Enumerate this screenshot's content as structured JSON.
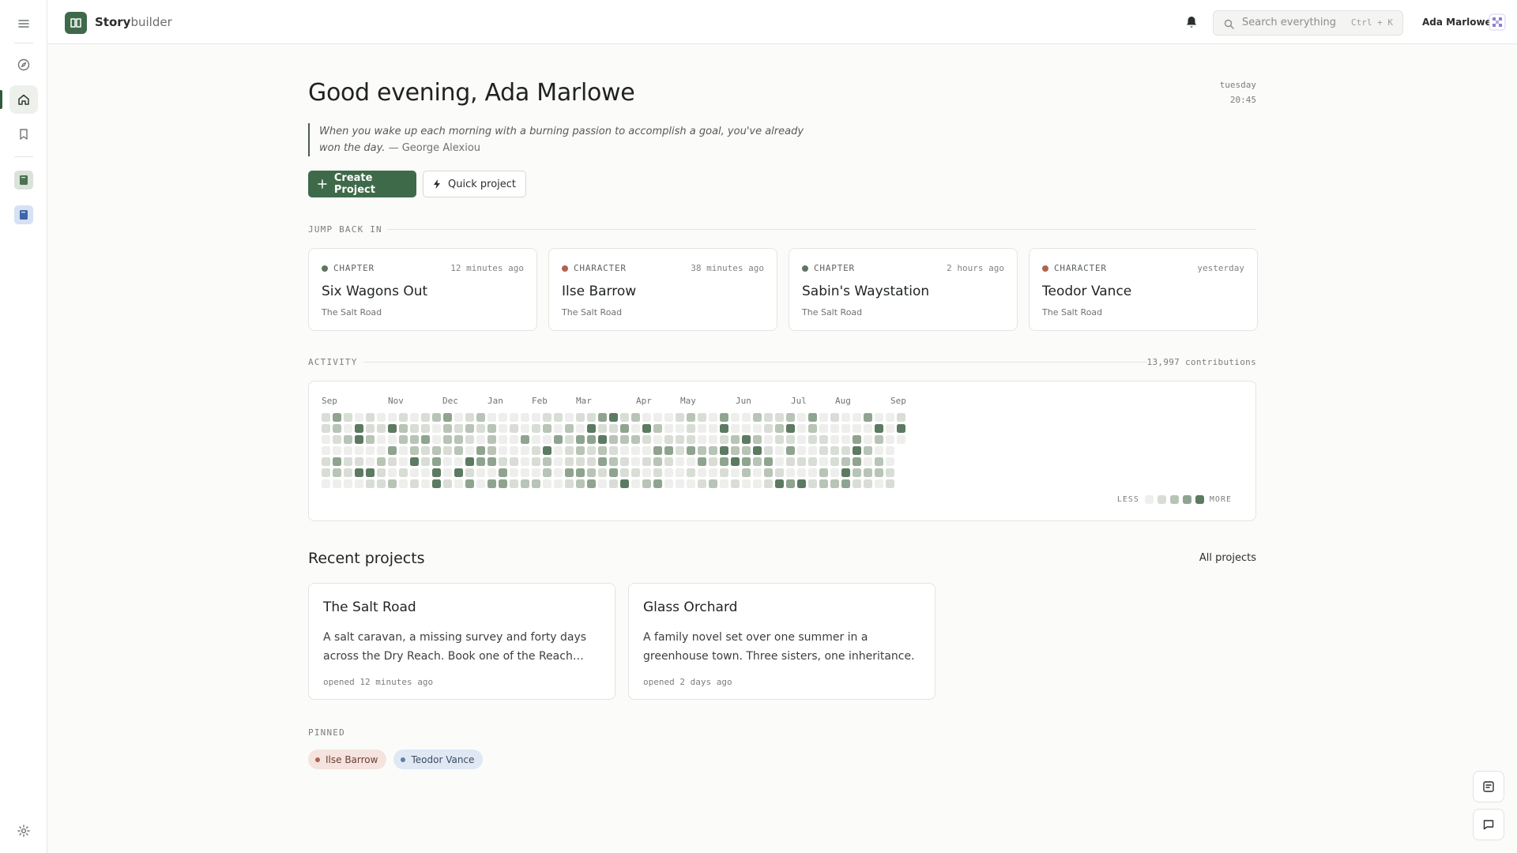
{
  "app": {
    "brand_bold": "Story",
    "brand_light": "builder"
  },
  "header": {
    "search_placeholder": "Search everything",
    "search_shortcut": "Ctrl + K",
    "user_name": "Ada Marlowe"
  },
  "sidebar": {
    "items": [
      {
        "name": "menu-icon"
      },
      {
        "name": "compass-icon"
      },
      {
        "name": "home-icon",
        "active": true
      },
      {
        "name": "bookmark-icon"
      },
      {
        "name": "book-green-icon"
      },
      {
        "name": "book-blue-icon"
      },
      {
        "name": "gear-icon"
      }
    ]
  },
  "greeting": {
    "title": "Good evening, Ada Marlowe",
    "day": "tuesday",
    "time": "20:45",
    "quote": "When you wake up each morning with a burning passion to accomplish a goal, you've already won the day.",
    "author": " — George Alexiou"
  },
  "actions": {
    "create_label": "Create Project",
    "quick_label": "Quick project"
  },
  "jump_back": {
    "label": "JUMP BACK IN",
    "items": [
      {
        "type": "CHAPTER",
        "time": "12 minutes ago",
        "title": "Six Wagons Out",
        "project": "The Salt Road",
        "dot": "#5e7561"
      },
      {
        "type": "CHARACTER",
        "time": "38 minutes ago",
        "title": "Ilse Barrow",
        "project": "The Salt Road",
        "dot": "#b0634d"
      },
      {
        "type": "CHAPTER",
        "time": "2 hours ago",
        "title": "Sabin's Waystation",
        "project": "The Salt Road",
        "dot": "#5e7561"
      },
      {
        "type": "CHARACTER",
        "time": "yesterday",
        "title": "Teodor Vance",
        "project": "The Salt Road",
        "dot": "#b0634d"
      }
    ]
  },
  "activity": {
    "label": "ACTIVITY",
    "contributions": "13,997 contributions",
    "months": [
      "Sep",
      "Nov",
      "Dec",
      "Jan",
      "Feb",
      "Mar",
      "Apr",
      "May",
      "Jun",
      "Jul",
      "Aug",
      "Sep"
    ],
    "legend_less": "LESS",
    "legend_more": "MORE",
    "colors": [
      "#eeeeec",
      "#d8ddd6",
      "#b8c4b6",
      "#8fa48f",
      "#5c7a61"
    ]
  },
  "recent": {
    "title": "Recent projects",
    "all_label": "All projects",
    "projects": [
      {
        "title": "The Salt Road",
        "description": "A salt caravan, a missing survey and forty days across the Dry Reach. Book one of the Reach trilogy.",
        "opened": "opened 12 minutes ago"
      },
      {
        "title": "Glass Orchard",
        "description": "A family novel set over one summer in a greenhouse town. Three sisters, one inheritance.",
        "opened": "opened 2 days ago"
      }
    ]
  },
  "pinned": {
    "label": "PINNED",
    "items": [
      {
        "label": "Ilse Barrow"
      },
      {
        "label": "Teodor Vance"
      }
    ]
  },
  "theme": {
    "accent": "#3f6a4a",
    "character_color": "#b0634d",
    "chapter_color": "#5e7561"
  }
}
